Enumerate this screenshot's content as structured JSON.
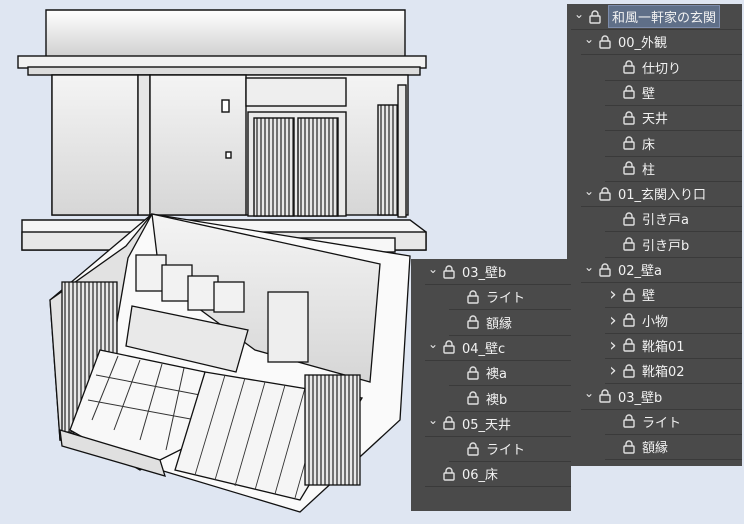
{
  "colors": {
    "panel_bg": "#4a4a4a",
    "text": "#f0f0f0",
    "selected_bg": "#5f6f88"
  },
  "icons": {
    "collapse": "chevron-down-icon",
    "expand": "chevron-right-icon",
    "item": "lock-icon"
  },
  "main_panel": {
    "items": [
      {
        "label": "和風一軒家の玄関",
        "expanded": true,
        "selected": true
      },
      {
        "label": "00_外観",
        "expanded": true
      },
      {
        "label": "仕切り"
      },
      {
        "label": "壁"
      },
      {
        "label": "天井"
      },
      {
        "label": "床"
      },
      {
        "label": "柱"
      },
      {
        "label": "01_玄関入り口",
        "expanded": true
      },
      {
        "label": "引き戸a"
      },
      {
        "label": "引き戸b"
      },
      {
        "label": "02_壁a",
        "expanded": true
      },
      {
        "label": "壁",
        "expanded": false
      },
      {
        "label": "小物",
        "expanded": false
      },
      {
        "label": "靴箱01",
        "expanded": false
      },
      {
        "label": "靴箱02",
        "expanded": false
      },
      {
        "label": "03_壁b",
        "expanded": true
      },
      {
        "label": "ライト"
      },
      {
        "label": "額縁"
      }
    ]
  },
  "secondary_panel": {
    "items": [
      {
        "label": "03_壁b",
        "expanded": true
      },
      {
        "label": "ライト"
      },
      {
        "label": "額縁"
      },
      {
        "label": "04_壁c",
        "expanded": true
      },
      {
        "label": "襖a"
      },
      {
        "label": "襖b"
      },
      {
        "label": "05_天井",
        "expanded": true
      },
      {
        "label": "ライト"
      },
      {
        "label": "06_床"
      }
    ]
  }
}
